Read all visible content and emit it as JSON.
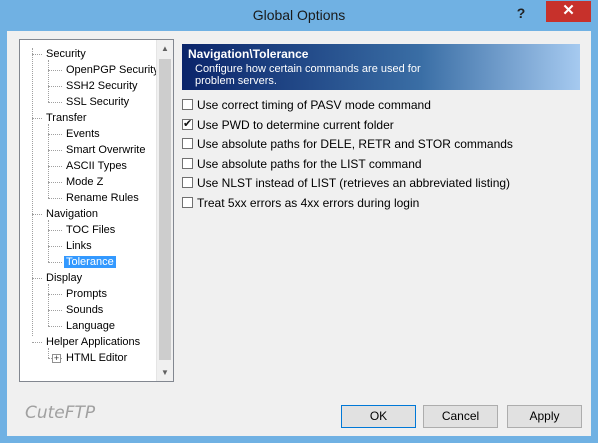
{
  "window": {
    "title": "Global Options",
    "help": "?",
    "close": "✕"
  },
  "tree": [
    {
      "label": "Security",
      "level": 0,
      "name": "tree-security"
    },
    {
      "label": "OpenPGP Security",
      "level": 1,
      "name": "tree-openpgp-security"
    },
    {
      "label": "SSH2 Security",
      "level": 1,
      "name": "tree-ssh2-security"
    },
    {
      "label": "SSL Security",
      "level": 1,
      "name": "tree-ssl-security"
    },
    {
      "label": "Transfer",
      "level": 0,
      "name": "tree-transfer"
    },
    {
      "label": "Events",
      "level": 1,
      "name": "tree-events"
    },
    {
      "label": "Smart Overwrite",
      "level": 1,
      "name": "tree-smart-overwrite"
    },
    {
      "label": "ASCII Types",
      "level": 1,
      "name": "tree-ascii-types"
    },
    {
      "label": "Mode Z",
      "level": 1,
      "name": "tree-mode-z"
    },
    {
      "label": "Rename Rules",
      "level": 1,
      "name": "tree-rename-rules"
    },
    {
      "label": "Navigation",
      "level": 0,
      "name": "tree-navigation"
    },
    {
      "label": "TOC Files",
      "level": 1,
      "name": "tree-toc-files"
    },
    {
      "label": "Links",
      "level": 1,
      "name": "tree-links"
    },
    {
      "label": "Tolerance",
      "level": 1,
      "name": "tree-tolerance",
      "selected": true
    },
    {
      "label": "Display",
      "level": 0,
      "name": "tree-display"
    },
    {
      "label": "Prompts",
      "level": 1,
      "name": "tree-prompts"
    },
    {
      "label": "Sounds",
      "level": 1,
      "name": "tree-sounds"
    },
    {
      "label": "Language",
      "level": 1,
      "name": "tree-language"
    },
    {
      "label": "Helper Applications",
      "level": 0,
      "name": "tree-helper-applications"
    },
    {
      "label": "HTML Editor",
      "level": 1,
      "name": "tree-html-editor",
      "expandable": true
    }
  ],
  "scroll": {
    "up": "▲",
    "down": "▼"
  },
  "header": {
    "title": "Navigation\\Tolerance",
    "description": "Configure how certain commands are used for problem servers."
  },
  "options": [
    {
      "label": "Use correct timing of PASV mode command",
      "checked": false,
      "name": "opt-pasv-timing"
    },
    {
      "label": "Use PWD to determine current folder",
      "checked": true,
      "name": "opt-use-pwd"
    },
    {
      "label": "Use absolute paths for DELE, RETR and STOR commands",
      "checked": false,
      "name": "opt-absolute-dele-retr-stor"
    },
    {
      "label": "Use absolute paths for the LIST command",
      "checked": false,
      "name": "opt-absolute-list"
    },
    {
      "label": "Use NLST instead of LIST (retrieves an abbreviated listing)",
      "checked": false,
      "name": "opt-use-nlst"
    },
    {
      "label": "Treat 5xx errors as 4xx errors during login",
      "checked": false,
      "name": "opt-treat-5xx"
    }
  ],
  "buttons": {
    "ok": "OK",
    "cancel": "Cancel",
    "apply": "Apply"
  },
  "brand": "CuteFTP",
  "colors": {
    "titlebar": "#70b1e3",
    "close": "#c7312b",
    "selection": "#3399ff",
    "banner_start": "#0a246a"
  }
}
